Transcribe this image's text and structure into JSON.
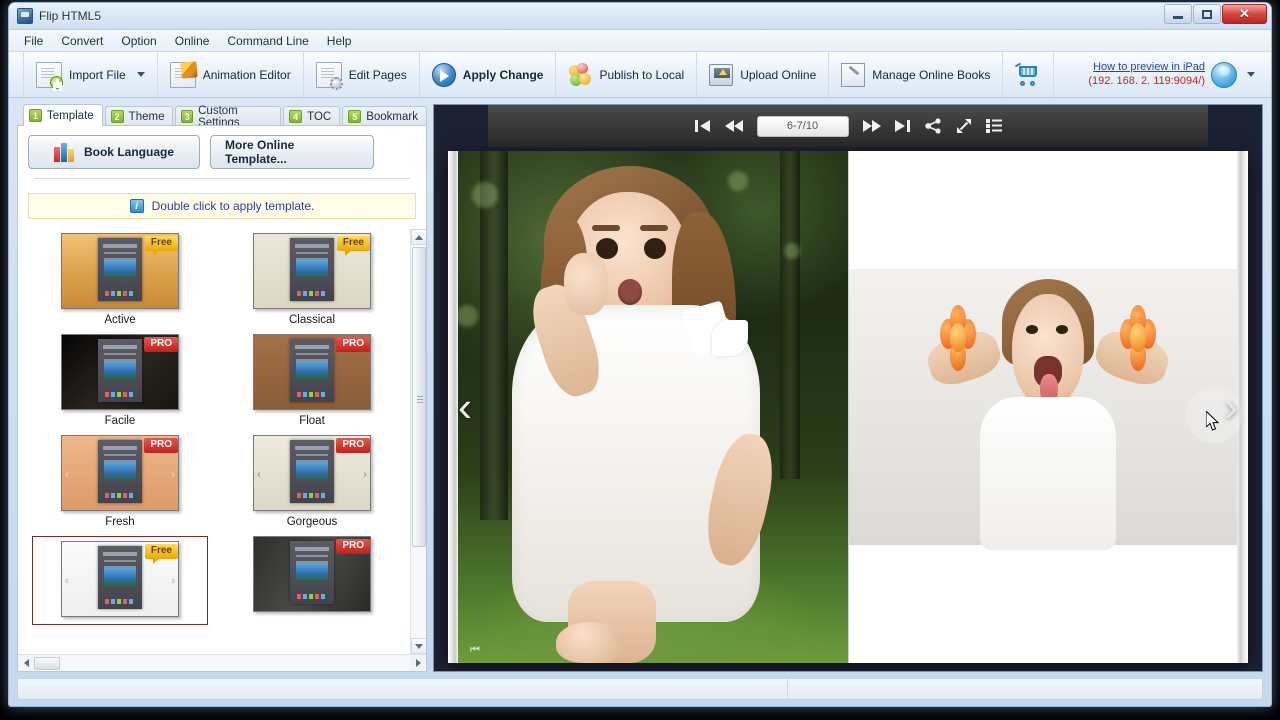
{
  "window": {
    "title": "Flip HTML5",
    "app_icon": "app-icon",
    "controls": {
      "minimize": "—",
      "maximize": "□",
      "close": "✕"
    }
  },
  "menu": {
    "items": [
      "File",
      "Convert",
      "Option",
      "Online",
      "Command Line",
      "Help"
    ]
  },
  "toolbar": {
    "buttons": [
      {
        "label": "Import File",
        "icon": "import-file-icon",
        "has_dropdown": true
      },
      {
        "label": "Animation Editor",
        "icon": "animation-editor-icon",
        "has_dropdown": false
      },
      {
        "label": "Edit Pages",
        "icon": "edit-pages-icon",
        "has_dropdown": false
      },
      {
        "label": "Apply Change",
        "icon": "apply-change-icon",
        "has_dropdown": false
      },
      {
        "label": "Publish to Local",
        "icon": "publish-to-local-icon",
        "has_dropdown": false
      },
      {
        "label": "Upload Online",
        "icon": "upload-online-icon",
        "has_dropdown": false
      },
      {
        "label": "Manage Online Books",
        "icon": "manage-online-books-icon",
        "has_dropdown": false
      }
    ],
    "cart_icon": "shopping-cart-icon",
    "ipad_link": "How to preview in iPad",
    "ipad_address": "(192. 168. 2. 119:9094/)",
    "avatar_icon": "user-avatar-icon",
    "link_color": "#2244cc",
    "address_color": "#cc2222"
  },
  "left_panel": {
    "tabs": [
      {
        "num": "1",
        "label": "Template",
        "active": true
      },
      {
        "num": "2",
        "label": "Theme",
        "active": false
      },
      {
        "num": "3",
        "label": "Custom Settings",
        "active": false
      },
      {
        "num": "4",
        "label": "TOC",
        "active": false
      },
      {
        "num": "5",
        "label": "Bookmark",
        "active": false
      }
    ],
    "tab_badge_color": "#8fc132",
    "buttons": {
      "book_language": "Book Language",
      "more_online_template": "More Online Template..."
    },
    "info_bar": {
      "icon": "info-icon",
      "text": "Double click to apply template.",
      "text_color": "#2a3fb0",
      "background": "#fffde8"
    },
    "templates": [
      {
        "name": "Active",
        "badge": "Free",
        "bg": "#e0a952",
        "selected": false
      },
      {
        "name": "Classical",
        "badge": "Free",
        "bg": "#e9e4d6",
        "selected": false
      },
      {
        "name": "Facile",
        "badge": "PRO",
        "bg": "#1c1713",
        "selected": false
      },
      {
        "name": "Float",
        "badge": "PRO",
        "bg": "#9a6a45",
        "selected": false
      },
      {
        "name": "Fresh",
        "badge": "PRO",
        "bg": "#e3a579",
        "selected": false
      },
      {
        "name": "Gorgeous",
        "badge": "PRO",
        "bg": "#e7e2d4",
        "selected": false
      },
      {
        "name": "",
        "badge": "Free",
        "bg": "#f4f4f4",
        "selected": true
      },
      {
        "name": "",
        "badge": "PRO",
        "bg": "#3b3b39",
        "selected": false
      }
    ],
    "badge_free_color": "#e8a800",
    "badge_pro_color": "#c1201a",
    "scrollbars": {
      "vertical": "vertical-scrollbar",
      "horizontal": "horizontal-scrollbar"
    }
  },
  "preview": {
    "player": {
      "first_page_icon": "first-page-icon",
      "prev_page_icon": "previous-page-icon",
      "page_indicator": "6-7/10",
      "next_page_icon": "next-page-icon",
      "last_page_icon": "last-page-icon",
      "share_icon": "share-icon",
      "fullscreen_icon": "fullscreen-icon",
      "thumbnails_icon": "thumbnails-icon"
    },
    "nav_prev": "‹",
    "nav_next": "›",
    "background": "#1d2233",
    "left_page_alt": "photo of surprised girl outdoors",
    "right_page_alt": "photo of girl with orange flowers sticking out tongue"
  },
  "status_bar": {
    "left_text": "",
    "right_text": ""
  }
}
